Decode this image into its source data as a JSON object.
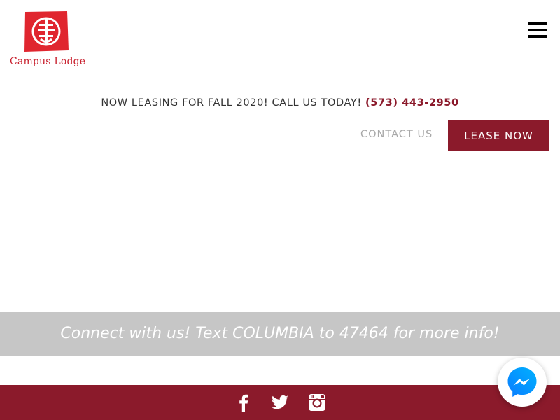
{
  "brand": {
    "name": "Campus Lodge",
    "primary_color": "#8b1a2b",
    "logo_color": "#e0262f"
  },
  "header": {
    "menu_icon": "hamburger-menu-icon"
  },
  "announcement": {
    "text": "NOW LEASING FOR FALL 2020! CALL US TODAY!",
    "phone": "(573) 443-2950"
  },
  "nav": {
    "contact_label": "CONTACT US",
    "lease_label": "LEASE NOW"
  },
  "connect": {
    "text": "Connect with us! Text COLUMBIA to 47464 for more info!",
    "background": "#c6c6c6"
  },
  "footer": {
    "social": [
      {
        "name": "facebook",
        "icon": "facebook-icon"
      },
      {
        "name": "twitter",
        "icon": "twitter-icon"
      },
      {
        "name": "instagram",
        "icon": "instagram-icon"
      }
    ]
  },
  "chat": {
    "icon": "messenger-icon"
  }
}
